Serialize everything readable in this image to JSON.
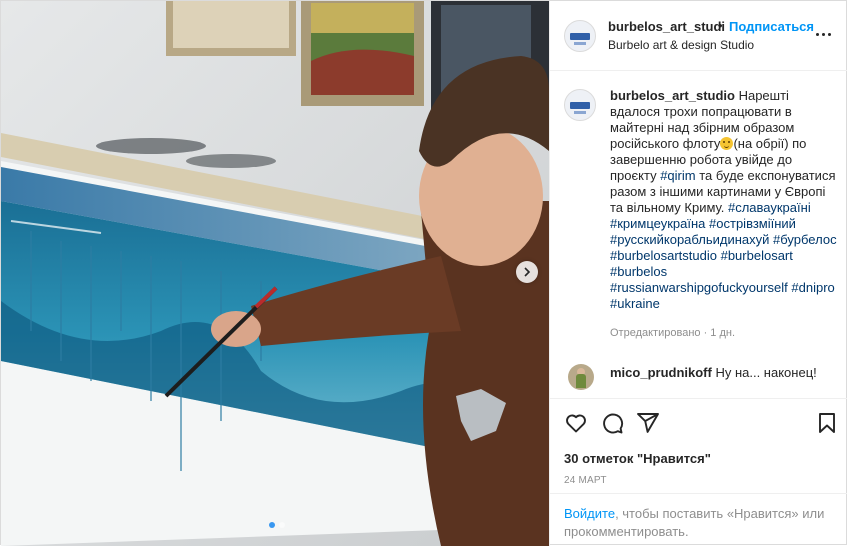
{
  "header": {
    "username": "burbelos_art_studi",
    "separator": "•",
    "follow_label": "Подписаться",
    "subtitle": "Burbelo art & design Studio"
  },
  "caption": {
    "username": "burbelos_art_studio",
    "text_1": " Нарешті вдалося трохи попрацювати в майтерні над збірним образом російського флоту",
    "text_2": "(на обрії) по завершенню робота увійде до проєкту ",
    "tag_qirim": "#qirim",
    "text_3": " та буде експонуватися разом з іншими картинами у Європі та вільному Криму. ",
    "hashtags": [
      "#славаукраїні",
      "#кримцеукраїна",
      "#острівзміїний",
      "#русскийкорабльидинахуй",
      "#бурбелос",
      "#burbelosartstudio",
      "#burbelosart",
      "#burbelos",
      "#russianwarshipgofuckyourself",
      "#dnipro",
      "#ukraine"
    ],
    "emoji_name": "grinning-face-emoji",
    "edited": "Отредактировано · 1 дн."
  },
  "comment": {
    "username": "mico_prudnikoff",
    "text": " Ну на... наконец!"
  },
  "actions": {
    "icons": [
      "heart-icon",
      "comment-icon",
      "share-icon",
      "bookmark-icon"
    ],
    "likes": "30 отметок \"Нравится\"",
    "date": "24 МАРТ"
  },
  "login": {
    "link": "Войдите",
    "text": ", чтобы поставить «Нравится» или прокомментировать."
  },
  "media": {
    "carousel_total": 2,
    "carousel_active": 1,
    "next_icon": "chevron-right-icon"
  },
  "colors": {
    "accent": "#0095f6",
    "hashtag": "#00376b",
    "muted": "#8e8e8e"
  }
}
